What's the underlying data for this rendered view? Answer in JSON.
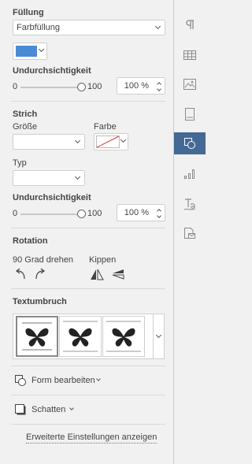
{
  "fill": {
    "heading": "Füllung",
    "type_value": "Farbfüllung",
    "color": "#4a8ad4",
    "opacity_heading": "Undurchsichtigkeit",
    "slider_min": "0",
    "slider_max": "100",
    "opacity_value": "100 %",
    "opacity_fraction": 1.0
  },
  "stroke": {
    "heading": "Strich",
    "size_label": "Größe",
    "color_label": "Farbe",
    "type_label": "Typ",
    "opacity_heading": "Undurchsichtigkeit",
    "slider_min": "0",
    "slider_max": "100",
    "opacity_value": "100 %",
    "opacity_fraction": 1.0
  },
  "rotation": {
    "heading": "Rotation",
    "rotate_label": "90 Grad drehen",
    "flip_label": "Kippen"
  },
  "wrap": {
    "heading": "Textumbruch",
    "styles": [
      "inline",
      "square",
      "tight"
    ]
  },
  "actions": {
    "edit_shape": "Form bearbeiten",
    "shadow": "Schatten",
    "advanced": "Erweiterte Einstellungen anzeigen"
  },
  "sidebar": {
    "items": [
      {
        "icon": "paragraph-icon"
      },
      {
        "icon": "table-icon"
      },
      {
        "icon": "image-icon"
      },
      {
        "icon": "header-footer-icon"
      },
      {
        "icon": "shape-icon",
        "active": true
      },
      {
        "icon": "chart-icon"
      },
      {
        "icon": "text-art-icon"
      },
      {
        "icon": "mail-merge-icon"
      }
    ]
  },
  "colors": {
    "accent": "#446995",
    "fill_swatch": "#4a8ad4"
  }
}
